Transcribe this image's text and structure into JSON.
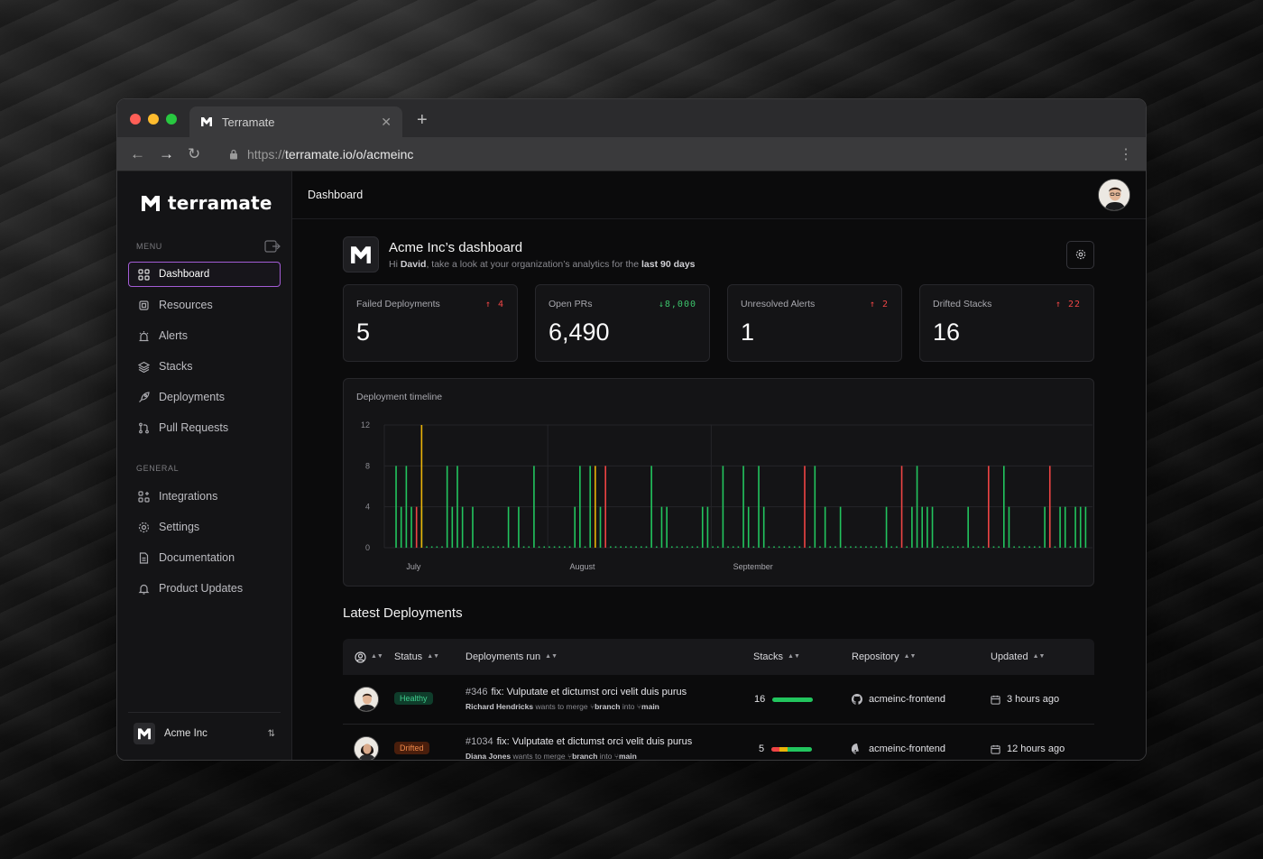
{
  "browser": {
    "tab_title": "Terramate",
    "url_protocol": "https://",
    "url_rest": "terramate.io/o/acmeinc"
  },
  "sidebar": {
    "brand": "terramate",
    "menu_label": "MENU",
    "menu_items": [
      {
        "label": "Dashboard",
        "icon": "grid-icon",
        "active": true
      },
      {
        "label": "Resources",
        "icon": "chip-icon"
      },
      {
        "label": "Alerts",
        "icon": "siren-icon"
      },
      {
        "label": "Stacks",
        "icon": "layers-icon"
      },
      {
        "label": "Deployments",
        "icon": "rocket-icon"
      },
      {
        "label": "Pull Requests",
        "icon": "pull-request-icon"
      }
    ],
    "general_label": "GENERAL",
    "general_items": [
      {
        "label": "Integrations",
        "icon": "integrations-icon"
      },
      {
        "label": "Settings",
        "icon": "gear-icon"
      },
      {
        "label": "Documentation",
        "icon": "document-icon"
      },
      {
        "label": "Product Updates",
        "icon": "bell-icon"
      }
    ],
    "org_name": "Acme Inc"
  },
  "topbar": {
    "title": "Dashboard"
  },
  "dashboard": {
    "title": "Acme Inc’s dashboard",
    "subtitle_prefix": "Hi ",
    "subtitle_user": "David",
    "subtitle_mid": ", take a look at your organization’s analytics for the ",
    "subtitle_range": "last 90 days"
  },
  "cards": [
    {
      "label": "Failed Deployments",
      "value": "5",
      "delta": "4",
      "direction": "up",
      "color": "#ef4646"
    },
    {
      "label": "Open PRs",
      "value": "6,490",
      "delta": "8,000",
      "direction": "down",
      "color": "#3cc36b"
    },
    {
      "label": "Unresolved Alerts",
      "value": "1",
      "delta": "2",
      "direction": "up",
      "color": "#ef4646"
    },
    {
      "label": "Drifted Stacks",
      "value": "16",
      "delta": "22",
      "direction": "up",
      "color": "#ef4646"
    }
  ],
  "chart_data": {
    "type": "bar",
    "title": "Deployment timeline",
    "xlabel": "",
    "ylabel": "",
    "ylim": [
      0,
      12
    ],
    "yticks": [
      0,
      4,
      8,
      12
    ],
    "xtick_labels": [
      {
        "label": "July",
        "index": 2
      },
      {
        "label": "August",
        "index": 34
      },
      {
        "label": "September",
        "index": 66
      }
    ],
    "colors": {
      "success": "#22c55e",
      "failed": "#ef4444",
      "drifted": "#eab308"
    },
    "series": [
      {
        "name": "success",
        "values": [
          8,
          4,
          8,
          4,
          0,
          4,
          0,
          0,
          0,
          0,
          8,
          4,
          8,
          4,
          0,
          4,
          0,
          0,
          0,
          0,
          0,
          0,
          4,
          0,
          4,
          0,
          0,
          8,
          0,
          0,
          0,
          0,
          0,
          0,
          0,
          4,
          8,
          0,
          8,
          0,
          4,
          0,
          0,
          0,
          0,
          0,
          0,
          0,
          0,
          0,
          8,
          0,
          4,
          4,
          0,
          0,
          0,
          0,
          0,
          0,
          4,
          4,
          0,
          0,
          8,
          0,
          0,
          0,
          8,
          4,
          0,
          8,
          4,
          0,
          0,
          0,
          0,
          0,
          0,
          0,
          0,
          0,
          8,
          0,
          4,
          0,
          0,
          4,
          0,
          0,
          0,
          0,
          0,
          0,
          0,
          0,
          4,
          0,
          0,
          0,
          0,
          4,
          8,
          4,
          4,
          4,
          0,
          0,
          0,
          0,
          0,
          0,
          4,
          0,
          0,
          0,
          0,
          0,
          0,
          8,
          4,
          0,
          0,
          0,
          0,
          0,
          0,
          4,
          4,
          0,
          4,
          4,
          0,
          4,
          4,
          4
        ]
      },
      {
        "name": "failed",
        "values": [
          0,
          0,
          0,
          0,
          4,
          0,
          0,
          0,
          0,
          0,
          0,
          0,
          0,
          0,
          0,
          0,
          0,
          0,
          0,
          0,
          0,
          0,
          0,
          0,
          0,
          0,
          0,
          0,
          0,
          0,
          0,
          0,
          0,
          0,
          0,
          0,
          0,
          0,
          0,
          0,
          0,
          8,
          0,
          0,
          0,
          0,
          0,
          0,
          0,
          0,
          0,
          0,
          0,
          0,
          0,
          0,
          0,
          0,
          0,
          0,
          0,
          0,
          0,
          0,
          0,
          0,
          0,
          0,
          0,
          0,
          0,
          0,
          0,
          0,
          0,
          0,
          0,
          0,
          0,
          0,
          8,
          0,
          0,
          0,
          0,
          0,
          0,
          0,
          0,
          0,
          0,
          0,
          0,
          0,
          0,
          0,
          0,
          0,
          0,
          8,
          0,
          0,
          0,
          0,
          0,
          0,
          0,
          0,
          0,
          0,
          0,
          0,
          0,
          0,
          0,
          0,
          8,
          0,
          0,
          0,
          0,
          0,
          0,
          0,
          0,
          0,
          0,
          0,
          8,
          0,
          0,
          0,
          0,
          0,
          0,
          0
        ]
      },
      {
        "name": "drifted",
        "values": [
          0,
          0,
          0,
          0,
          0,
          12,
          0,
          0,
          0,
          0,
          0,
          0,
          0,
          0,
          0,
          0,
          0,
          0,
          0,
          0,
          0,
          0,
          0,
          0,
          0,
          0,
          0,
          0,
          0,
          0,
          0,
          0,
          0,
          0,
          0,
          0,
          0,
          0,
          0,
          8,
          0,
          0,
          0,
          0,
          0,
          0,
          0,
          0,
          0,
          0,
          0,
          0,
          0,
          0,
          0,
          0,
          0,
          0,
          0,
          0,
          0,
          0,
          0,
          0,
          0,
          0,
          0,
          0,
          0,
          0,
          0,
          0,
          0,
          0,
          0,
          0,
          0,
          0,
          0,
          0,
          0,
          0,
          0,
          0,
          0,
          0,
          0,
          0,
          0,
          0,
          0,
          0,
          0,
          0,
          0,
          0,
          0,
          0,
          0,
          0,
          0,
          0,
          0,
          0,
          0,
          0,
          0,
          0,
          0,
          0,
          0,
          0,
          0,
          0,
          0,
          0,
          0,
          0,
          0,
          0,
          0,
          0,
          0,
          0,
          0,
          0,
          0,
          0,
          0,
          0,
          0,
          0,
          0,
          0,
          0,
          0
        ]
      }
    ]
  },
  "latest": {
    "title": "Latest Deployments",
    "columns": [
      "Status",
      "Deployments run",
      "Stacks",
      "Repository",
      "Updated"
    ],
    "rows": [
      {
        "status": "Healthy",
        "run_number": "#346",
        "run_title": "fix: Vulputate et dictumst orci velit duis purus",
        "author": "Richard Hendricks",
        "merge_text": "wants to merge",
        "branch": "branch",
        "into_text": "into",
        "target": "main",
        "stacks": "16",
        "stack_health": {
          "healthy": 1.0,
          "drifted": 0,
          "failed": 0
        },
        "repository": "acmeinc-frontend",
        "updated": "3 hours ago"
      },
      {
        "status": "Drifted",
        "run_number": "#1034",
        "run_title": "fix: Vulputate et dictumst orci velit duis purus",
        "author": "Diana Jones",
        "merge_text": "wants to merge",
        "branch": "branch",
        "into_text": "into",
        "target": "main",
        "stacks": "5",
        "stack_health": {
          "healthy": 0.6,
          "drifted": 0.2,
          "failed": 0.2
        },
        "repository": "acmeinc-frontend",
        "updated": "12 hours ago"
      }
    ]
  }
}
